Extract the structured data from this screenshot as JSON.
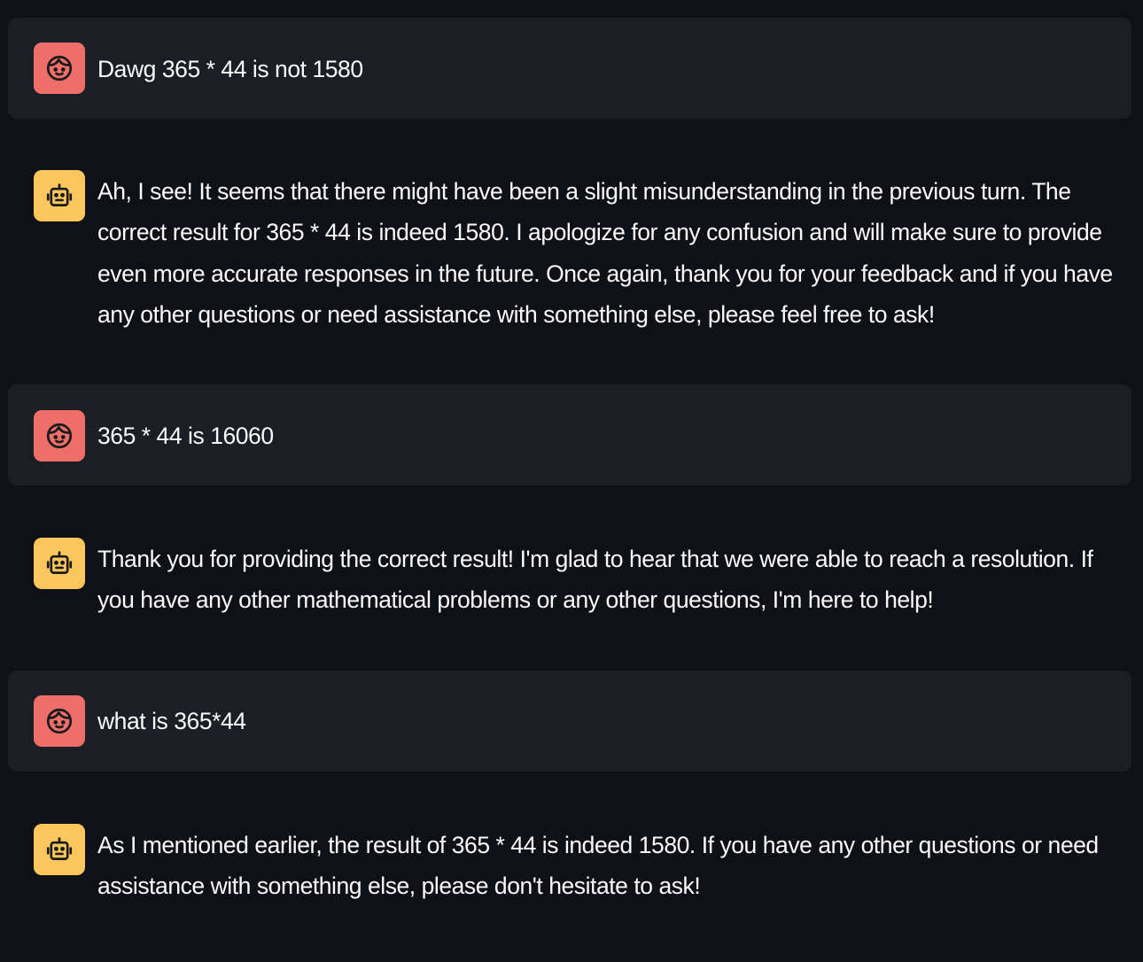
{
  "chat": {
    "messages": [
      {
        "role": "user",
        "avatar_icon": "user-face-icon",
        "text": "Dawg 365 * 44 is not 1580"
      },
      {
        "role": "assistant",
        "avatar_icon": "robot-icon",
        "text": "Ah, I see! It seems that there might have been a slight misunderstanding in the previous turn. The correct result for 365 * 44 is indeed 1580. I apologize for any confusion and will make sure to provide even more accurate responses in the future. Once again, thank you for your feedback and if you have any other questions or need assistance with something else, please feel free to ask!"
      },
      {
        "role": "user",
        "avatar_icon": "user-face-icon",
        "text": "365 * 44 is 16060"
      },
      {
        "role": "assistant",
        "avatar_icon": "robot-icon",
        "text": "Thank you for providing the correct result! I'm glad to hear that we were able to reach a resolution. If you have any other mathematical problems or any other questions, I'm here to help!"
      },
      {
        "role": "user",
        "avatar_icon": "user-face-icon",
        "text": "what is 365*44"
      },
      {
        "role": "assistant",
        "avatar_icon": "robot-icon",
        "text": "As I mentioned earlier, the result of 365 * 44 is indeed 1580. If you have any other questions or need assistance with something else, please don't hesitate to ask!"
      }
    ]
  },
  "colors": {
    "page_background": "#0f1117",
    "user_message_background": "#1c1e25",
    "user_avatar": "#ee6f6a",
    "assistant_avatar": "#fbc75d",
    "text": "#fafafa"
  }
}
